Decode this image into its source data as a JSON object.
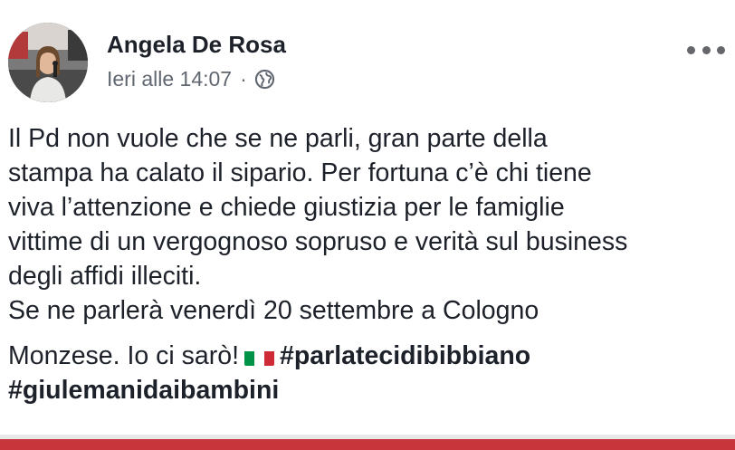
{
  "post": {
    "author": "Angela De Rosa",
    "timestamp": "Ieri alle 14:07",
    "separator": "·",
    "privacy_icon": "globe-icon",
    "more_icon": "more-options-icon",
    "lines": [
      "Il Pd non vuole che se ne parli, gran parte della",
      "stampa ha calato il sipario. Per fortuna c’è chi tiene",
      "viva l’attenzione e chiede giustizia per le famiglie",
      "vittime di un vergognoso sopruso e verità sul business",
      "degli affidi illeciti.",
      "Se ne parlerà venerdì 20 settembre a Cologno"
    ],
    "last_line_text": "Monzese. Io ci sarò!",
    "flag_icon": "italy-flag-icon",
    "hashtags": [
      "#parlatecidibibbiano",
      "#giulemanidaibambini"
    ]
  },
  "colors": {
    "text": "#1d2129",
    "meta": "#606770",
    "bottom_bar": "#c8353a",
    "flag_green": "#009246",
    "flag_white": "#ffffff",
    "flag_red": "#ce2b37"
  }
}
